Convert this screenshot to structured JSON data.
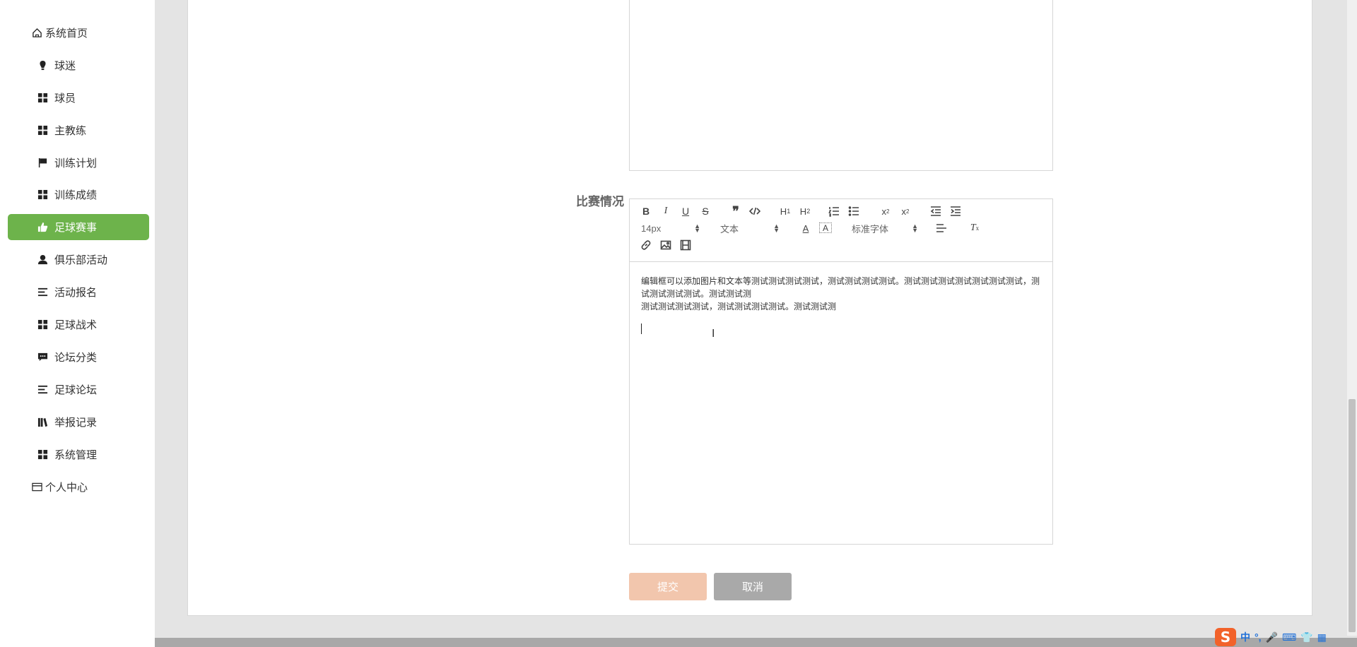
{
  "sidebar": {
    "items": [
      {
        "label": "系统首页",
        "icon": "home-icon"
      },
      {
        "label": "球迷",
        "icon": "bulb-icon"
      },
      {
        "label": "球员",
        "icon": "grid-icon"
      },
      {
        "label": "主教练",
        "icon": "grid-icon"
      },
      {
        "label": "训练计划",
        "icon": "flag-icon"
      },
      {
        "label": "训练成绩",
        "icon": "grid-icon"
      },
      {
        "label": "足球赛事",
        "icon": "thumb-icon",
        "active": true
      },
      {
        "label": "俱乐部活动",
        "icon": "person-icon"
      },
      {
        "label": "活动报名",
        "icon": "list-icon"
      },
      {
        "label": "足球战术",
        "icon": "grid-icon"
      },
      {
        "label": "论坛分类",
        "icon": "chat-icon"
      },
      {
        "label": "足球论坛",
        "icon": "list-icon"
      },
      {
        "label": "举报记录",
        "icon": "book-icon"
      },
      {
        "label": "系统管理",
        "icon": "grid-icon"
      },
      {
        "label": "个人中心",
        "icon": "card-icon"
      }
    ]
  },
  "form": {
    "label": "比赛情况",
    "toolbar": {
      "font_size": "14px",
      "header": "文本",
      "font_family": "标准字体"
    },
    "content_lines": [
      "编辑框可以添加图片和文本等测试测试测试测试，测试测试测试测试。测试测试测试测试测试测试测试，测试测试测试测试。测试测试测",
      "测试测试测试测试，测试测试测试测试。测试测试测"
    ],
    "submit_label": "提交",
    "cancel_label": "取消"
  },
  "tray": {
    "logo": "S",
    "ime_mode": "中"
  },
  "colors": {
    "active_nav": "#6db34b",
    "submit_button": "#f2c6ad",
    "cancel_button": "#a9a9a9"
  }
}
